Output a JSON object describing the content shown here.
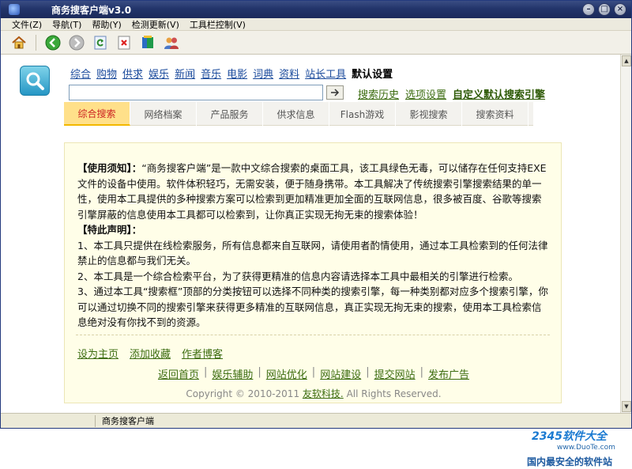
{
  "window": {
    "title": "商务搜客户端v3.0"
  },
  "menu": [
    "文件(Z)",
    "导航(T)",
    "帮助(Y)",
    "检测更新(V)",
    "工具栏控制(V)"
  ],
  "toolbar": {
    "buttons": [
      "home-icon",
      "back-icon",
      "forward-icon",
      "refresh-icon",
      "stop-icon",
      "page-icon",
      "users-icon"
    ]
  },
  "search": {
    "categories": [
      "综合",
      "购物",
      "供求",
      "娱乐",
      "新闻",
      "音乐",
      "电影",
      "词典",
      "资料",
      "站长工具",
      "默认设置"
    ],
    "active_category": "默认设置",
    "input_value": "",
    "options": [
      "搜索历史",
      "选项设置",
      "自定义默认搜索引擎"
    ]
  },
  "tabs": [
    "综合搜索",
    "网络档案",
    "产品服务",
    "供求信息",
    "Flash游戏",
    "影视搜索",
    "搜索资料"
  ],
  "active_tab": "综合搜索",
  "notice": {
    "heading1": "【使用须知】：",
    "para1": "“商务搜客户端”是一款中文综合搜索的桌面工具，该工具绿色无毒，可以储存在任何支持EXE文件的设备中使用。软件体积轻巧，无需安装，便于随身携带。本工具解决了传统搜索引擎搜索结果的单一性，使用本工具提供的多种搜索方案可以检索到更加精准更加全面的互联网信息，很多被百度、谷歌等搜索引擎屏蔽的信息使用本工具都可以检索到，让你真正实现无拘无束的搜索体验！",
    "heading2": "【特此声明】：",
    "item1": "1、本工具只提供在线检索服务，所有信息都来自互联网，请使用者酌情使用，通过本工具检索到的任何法律禁止的信息都与我们无关。",
    "item2": "2、本工具是一个综合检索平台，为了获得更精准的信息内容请选择本工具中最相关的引擎进行检索。",
    "item3": "3、通过本工具“搜索框”顶部的分类按钮可以选择不同种类的搜索引擎，每一种类别都对应多个搜索引擎，你可以通过切换不同的搜索引擎来获得更多精准的互联网信息，真正实现无拘无束的搜索，使用本工具检索信息绝对没有你找不到的资源。"
  },
  "links_row1": [
    "设为主页",
    "添加收藏",
    "作者博客"
  ],
  "links_row2": [
    "返回首页",
    "娱乐辅助",
    "网站优化",
    "网站建设",
    "提交网站",
    "发布广告"
  ],
  "copyright": {
    "prefix": "Copyright © 2010-2011",
    "company": "友软科技.",
    "suffix": "All Rights Reserved."
  },
  "statusbar": {
    "text": "商务搜客户端"
  },
  "watermark": {
    "brand": "2345软件大全",
    "url": "www.DuoTe.com",
    "slogan": "国内最安全的软件站"
  },
  "colors": {
    "titlebar": "#23356b",
    "tab_active": "#ffe08a",
    "link_green": "#3d6d12",
    "notice_bg": "#fffee8"
  }
}
